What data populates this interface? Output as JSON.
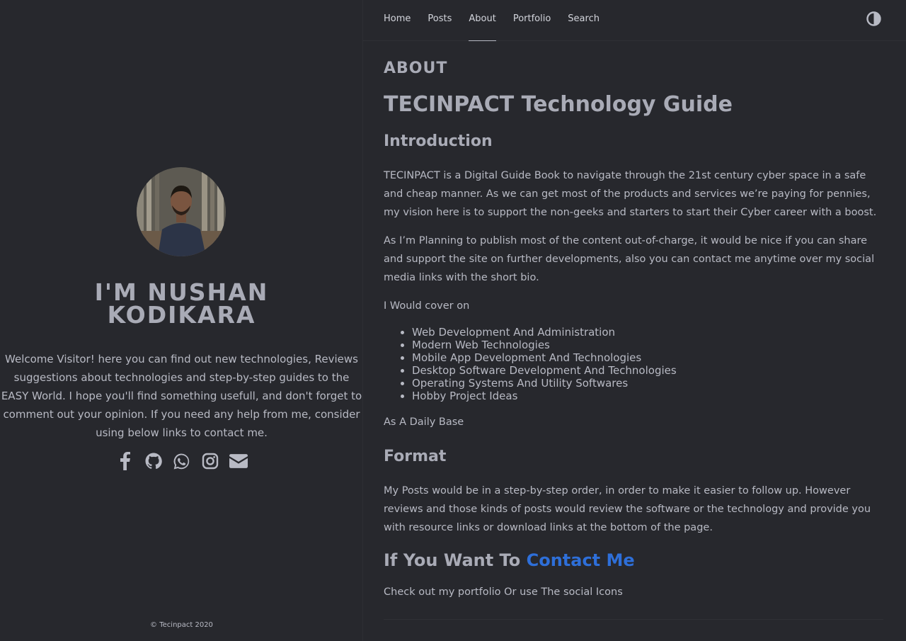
{
  "sidebar": {
    "name_line1": "I'M NUSHAN",
    "name_line2": "KODIKARA",
    "welcome": "Welcome Visitor! here you can find out new technologies, Reviews suggestions about technologies and step-by-step guides to the EASY World. I hope you'll find something usefull, and don't forget to comment out your opinion. If you need any help from me, consider using below links to contact me.",
    "social_icons": [
      "facebook-icon",
      "github-icon",
      "whatsapp-icon",
      "instagram-icon",
      "envelope-icon"
    ],
    "copyright": "© Tecinpact 2020"
  },
  "nav": {
    "items": [
      {
        "label": "Home"
      },
      {
        "label": "Posts"
      },
      {
        "label": "About",
        "active": true
      },
      {
        "label": "Portfolio"
      },
      {
        "label": "Search"
      }
    ],
    "theme_toggle_icon": "contrast-icon"
  },
  "content": {
    "page_label": "ABOUT",
    "title": "TECINPACT Technology Guide",
    "intro_heading": "Introduction",
    "intro_p1": "TECINPACT is a Digital Guide Book to navigate through the 21st century cyber space in a safe and cheap manner. As we can get most of the products and services we’re paying for pennies, my vision here is to support the non-geeks and starters to start their Cyber career with a boost.",
    "intro_p2": "As I’m Planning to publish most of the content out-of-charge, it would be nice if you can share and support the site on further developments, also you can contact me anytime over my social media links with the short bio.",
    "cover_intro": "I Would cover on",
    "cover_items": [
      "Web Development And Administration",
      "Modern Web Technologies",
      "Mobile App Development And Technologies",
      "Desktop Software Development And Technologies",
      "Operating Systems And Utility Softwares",
      "Hobby Project Ideas"
    ],
    "daily_base": "As A Daily Base",
    "format_heading": "Format",
    "format_p": "My Posts would be in a step-by-step order, in order to make it easier to follow up. However reviews and those kinds of posts would review the software or the technology and provide you with resource links or download links at the bottom of the page.",
    "contact_heading_prefix": "If You Want To ",
    "contact_heading_link": "Contact Me",
    "contact_p": "Check out my portfolio Or use The social Icons"
  },
  "colors": {
    "background": "#27282d",
    "text": "#b8bac4",
    "heading": "#a9abb6",
    "link": "#2e6fd9"
  }
}
